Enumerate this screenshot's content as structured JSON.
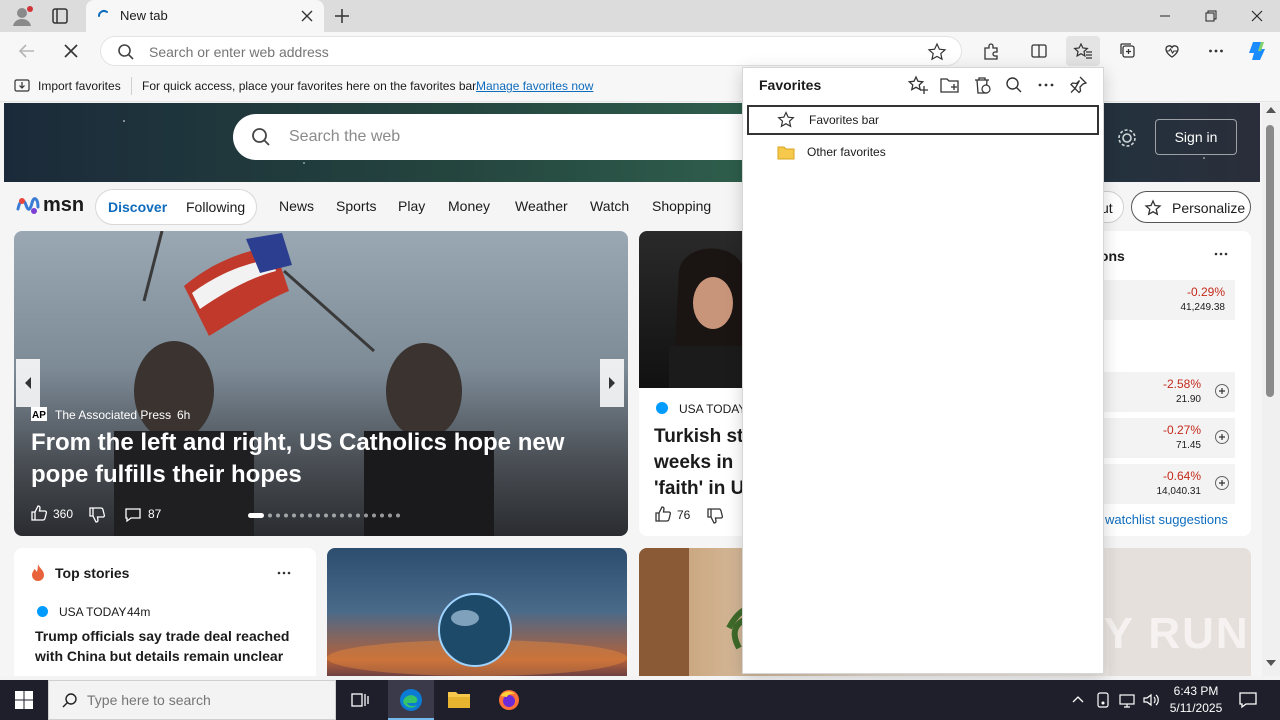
{
  "browser": {
    "tab_title": "New tab",
    "address_placeholder": "Search or enter web address"
  },
  "favorites_bar": {
    "import_label": "Import favorites",
    "hint": "For quick access, place your favorites here on the favorites bar.",
    "manage_link": "Manage favorites now"
  },
  "favorites_panel": {
    "title": "Favorites",
    "items": [
      {
        "label": "Favorites bar",
        "icon": "star-outline-icon"
      },
      {
        "label": "Other favorites",
        "icon": "folder-icon"
      }
    ]
  },
  "msn": {
    "logo": "msn",
    "search_placeholder": "Search the web",
    "sign_in": "Sign in",
    "pill_tabs": [
      "Discover",
      "Following"
    ],
    "nav": [
      "News",
      "Sports",
      "Play",
      "Money",
      "Weather",
      "Watch",
      "Shopping"
    ],
    "layout_btn_partial": "ut",
    "personalize": "Personalize"
  },
  "hero_story": {
    "source": "The Associated Press",
    "age": "6h",
    "headline": "From the left and right, US Catholics hope new pope fulfills their hopes",
    "likes": "360",
    "comments": "87"
  },
  "second_story": {
    "source": "USA TODAY",
    "headline_partial": "Turkish st\nweeks in \n'faith' in U",
    "likes": "76"
  },
  "watchlist": {
    "title_partial": "ions",
    "rows": [
      {
        "change": "-0.29%",
        "price": "41,249.38"
      },
      {
        "change": "-2.58%",
        "price": "21.90"
      },
      {
        "change": "-0.27%",
        "price": "71.45"
      },
      {
        "change": "-0.64%",
        "price": "14,040.31"
      }
    ],
    "suggestions_link": "watchlist suggestions"
  },
  "top_stories": {
    "title": "Top stories",
    "source": "USA TODAY",
    "age": "44m",
    "headline": "Trump officials say trade deal reached with China but details remain unclear"
  },
  "taskbar": {
    "search_placeholder": "Type here to search",
    "time": "6:43 PM",
    "date": "5/11/2025"
  },
  "watermark": "ANY RUN",
  "colors": {
    "accent": "#0f6cbd",
    "negative": "#c42b1c",
    "taskbar": "#1f1f2b"
  }
}
